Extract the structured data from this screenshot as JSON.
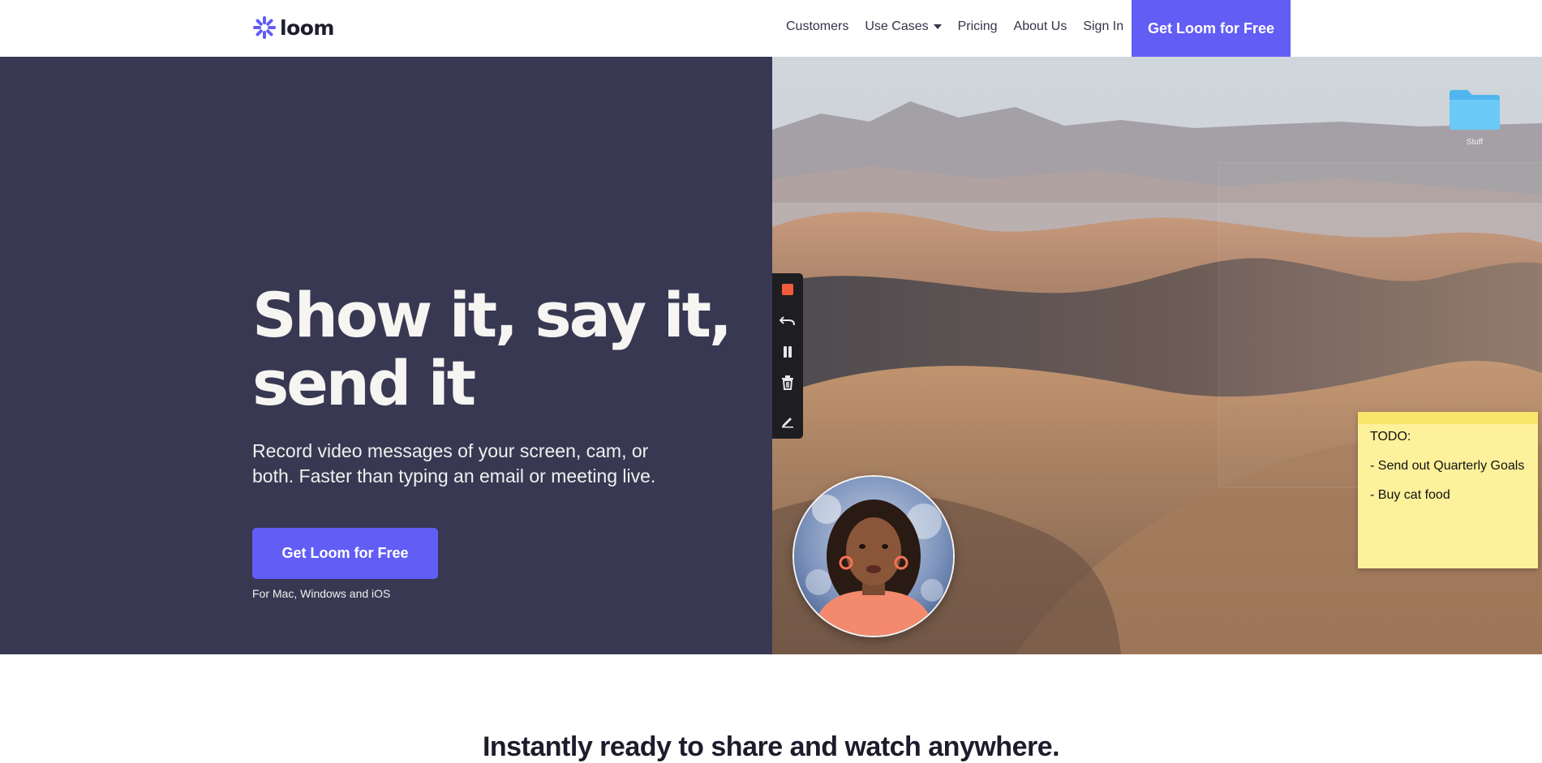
{
  "brand": {
    "name": "loom",
    "accent": "#625df5",
    "hero_bg": "#383853"
  },
  "nav": {
    "links": [
      "Customers",
      "Use Cases",
      "Pricing",
      "About Us",
      "Sign In"
    ],
    "cta": "Get Loom for Free"
  },
  "hero": {
    "headline_line1": "Show it, say it,",
    "headline_line2": "send it",
    "subhead_line1": "Record video messages of your screen, cam, or",
    "subhead_line2": "both. Faster than typing an email or meeting live.",
    "cta": "Get Loom for Free",
    "platforms": "For Mac, Windows and iOS"
  },
  "desktop": {
    "folder_label": "Stuff",
    "sticky_note": {
      "title": "TODO:",
      "items": [
        "- Send out Quarterly Goals",
        "- Buy cat food"
      ]
    },
    "toolbar_icons": [
      "stop-record-icon",
      "undo-icon",
      "pause-icon",
      "trash-icon",
      "pen-icon"
    ]
  },
  "section": {
    "title": "Instantly ready to share and watch anywhere."
  }
}
